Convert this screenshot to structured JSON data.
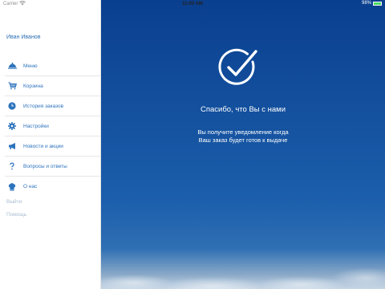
{
  "status_bar": {
    "carrier": "Carrier",
    "wifi_icon": "wifi-icon",
    "time": "11:00 AM",
    "battery": "98%"
  },
  "sidebar": {
    "user_name": "Иван Иванов",
    "items": [
      {
        "label": "Меню",
        "icon": "cloche-icon"
      },
      {
        "label": "Корзина",
        "icon": "cart-icon"
      },
      {
        "label": "История заказов",
        "icon": "clock-icon"
      },
      {
        "label": "Настройки",
        "icon": "gear-icon"
      },
      {
        "label": "Новости и акции",
        "icon": "megaphone-icon"
      },
      {
        "label": "Вопросы и ответы",
        "icon": "question-icon"
      },
      {
        "label": "О нас",
        "icon": "chef-hat-icon"
      }
    ],
    "logout": "Выйти",
    "help": "Помощь"
  },
  "main": {
    "title": "Спасибо, что Вы с нами",
    "message_line1": "Вы получите уведомление когда",
    "message_line2": "Ваш заказ будет готов к выдаче",
    "icon": "checkmark-circle-icon"
  },
  "colors": {
    "accent": "#2d73bd",
    "main_bg": "#14519f",
    "secondary_text": "#a9bcd0"
  }
}
